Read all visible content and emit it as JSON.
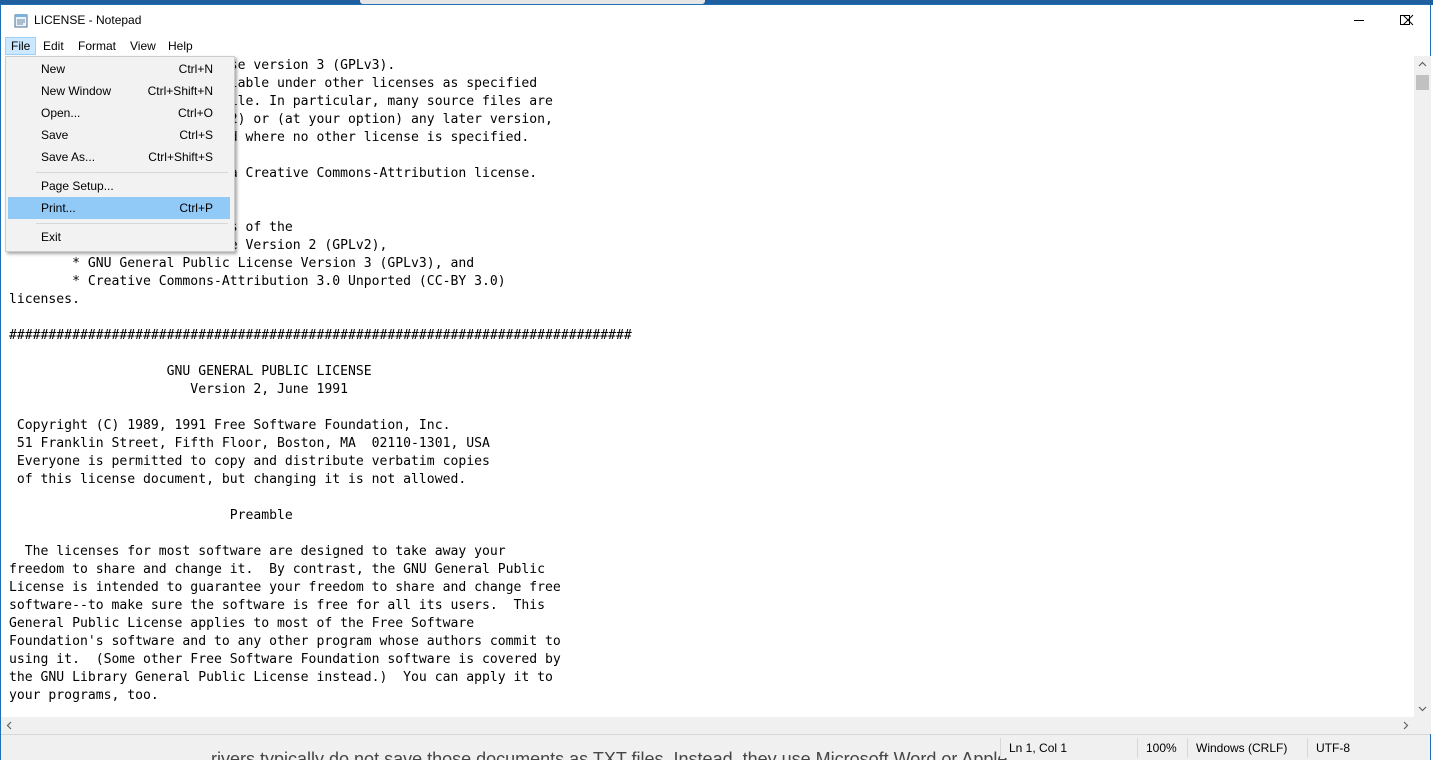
{
  "window": {
    "title": "LICENSE - Notepad"
  },
  "menubar": {
    "items": [
      "File",
      "Edit",
      "Format",
      "View",
      "Help"
    ],
    "active": "File"
  },
  "file_menu": {
    "items": [
      {
        "label": "New",
        "shortcut": "Ctrl+N"
      },
      {
        "label": "New Window",
        "shortcut": "Ctrl+Shift+N"
      },
      {
        "label": "Open...",
        "shortcut": "Ctrl+O"
      },
      {
        "label": "Save",
        "shortcut": "Ctrl+S"
      },
      {
        "label": "Save As...",
        "shortcut": "Ctrl+Shift+S"
      },
      {
        "label": "Page Setup...",
        "shortcut": ""
      },
      {
        "label": "Print...",
        "shortcut": "Ctrl+P",
        "highlighted": true
      },
      {
        "label": "Exit",
        "shortcut": ""
      }
    ]
  },
  "editor": {
    "text": "the GNU General Public License version 3 (GPLv3).\n                     be available under other licenses as specified\n                     nying file. In particular, many source files are\n                     2 (GPLv2) or (at your option) any later version,\n                     nse used where no other license is specified.\n\n                      under a Creative Commons-Attribution license.\n\n\n                     se texts of the\n                      License Version 2 (GPLv2),\n        * GNU General Public License Version 3 (GPLv3), and\n        * Creative Commons-Attribution 3.0 Unported (CC-BY 3.0)\nlicenses.\n\n###############################################################################\n\n                    GNU GENERAL PUBLIC LICENSE\n                       Version 2, June 1991\n\n Copyright (C) 1989, 1991 Free Software Foundation, Inc.\n 51 Franklin Street, Fifth Floor, Boston, MA  02110-1301, USA\n Everyone is permitted to copy and distribute verbatim copies\n of this license document, but changing it is not allowed.\n\n                            Preamble\n\n  The licenses for most software are designed to take away your\nfreedom to share and change it.  By contrast, the GNU General Public\nLicense is intended to guarantee your freedom to share and change free\nsoftware--to make sure the software is free for all its users.  This\nGeneral Public License applies to most of the Free Software\nFoundation's software and to any other program whose authors commit to\nusing it.  (Some other Free Software Foundation software is covered by\nthe GNU Library General Public License instead.)  You can apply it to\nyour programs, too."
  },
  "statusbar": {
    "position": "Ln 1, Col 1",
    "zoom": "100%",
    "line_ending": "Windows (CRLF)",
    "encoding": "UTF-8"
  },
  "background_text": "rivers typically do not save those documents as TXT files. Instead, they use Microsoft Word or Apple"
}
